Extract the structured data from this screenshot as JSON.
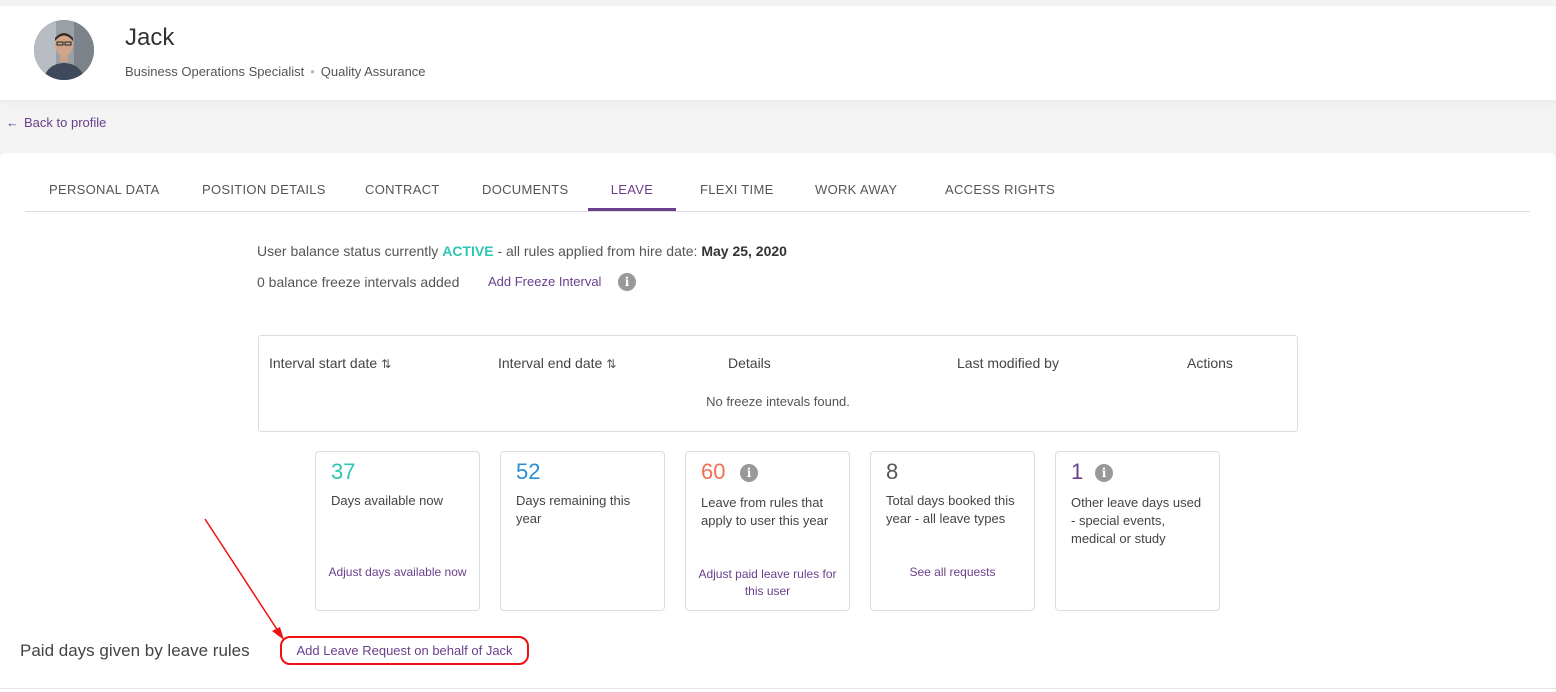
{
  "profile": {
    "name": "Jack",
    "job_title": "Business Operations Specialist",
    "department": "Quality Assurance"
  },
  "nav": {
    "back_label": "Back to profile"
  },
  "tabs": [
    {
      "label": "PERSONAL DATA"
    },
    {
      "label": "POSITION DETAILS"
    },
    {
      "label": "CONTRACT"
    },
    {
      "label": "DOCUMENTS"
    },
    {
      "label": "LEAVE",
      "active": true
    },
    {
      "label": "FLEXI TIME"
    },
    {
      "label": "WORK AWAY"
    },
    {
      "label": "ACCESS RIGHTS"
    }
  ],
  "balance": {
    "prefix": "User balance status currently",
    "status": "ACTIVE",
    "middle": "- all rules applied from hire date:",
    "hire_date": "May 25, 2020",
    "freeze_count_text": "0 balance freeze intervals added",
    "add_freeze_label": "Add Freeze Interval"
  },
  "freeze_table": {
    "columns": [
      "Interval start date",
      "Interval end date",
      "Details",
      "Last modified by",
      "Actions"
    ],
    "empty_text": "No freeze intevals found."
  },
  "cards": [
    {
      "value": "37",
      "color": "#2fc5b5",
      "desc": "Days available now",
      "link": "Adjust days available now",
      "info": false
    },
    {
      "value": "52",
      "color": "#2a8fd1",
      "desc": "Days remaining this year",
      "link": "",
      "info": false
    },
    {
      "value": "60",
      "color": "#f07050",
      "desc": "Leave from rules that apply to user this year",
      "link": "Adjust paid leave rules for this user",
      "info": true
    },
    {
      "value": "8",
      "color": "#555555",
      "desc": "Total days booked this year - all leave types",
      "link": "See all requests",
      "info": false
    },
    {
      "value": "1",
      "color": "#6a3f8c",
      "desc": "Other leave days used - special events, medical or study",
      "link": "",
      "info": true
    }
  ],
  "section": {
    "title": "Paid days given by leave rules",
    "add_leave_label": "Add Leave Request on behalf of Jack"
  },
  "colors": {
    "accent": "#6a3f8c",
    "active": "#2fc5b5",
    "annotation": "#ee1111"
  }
}
